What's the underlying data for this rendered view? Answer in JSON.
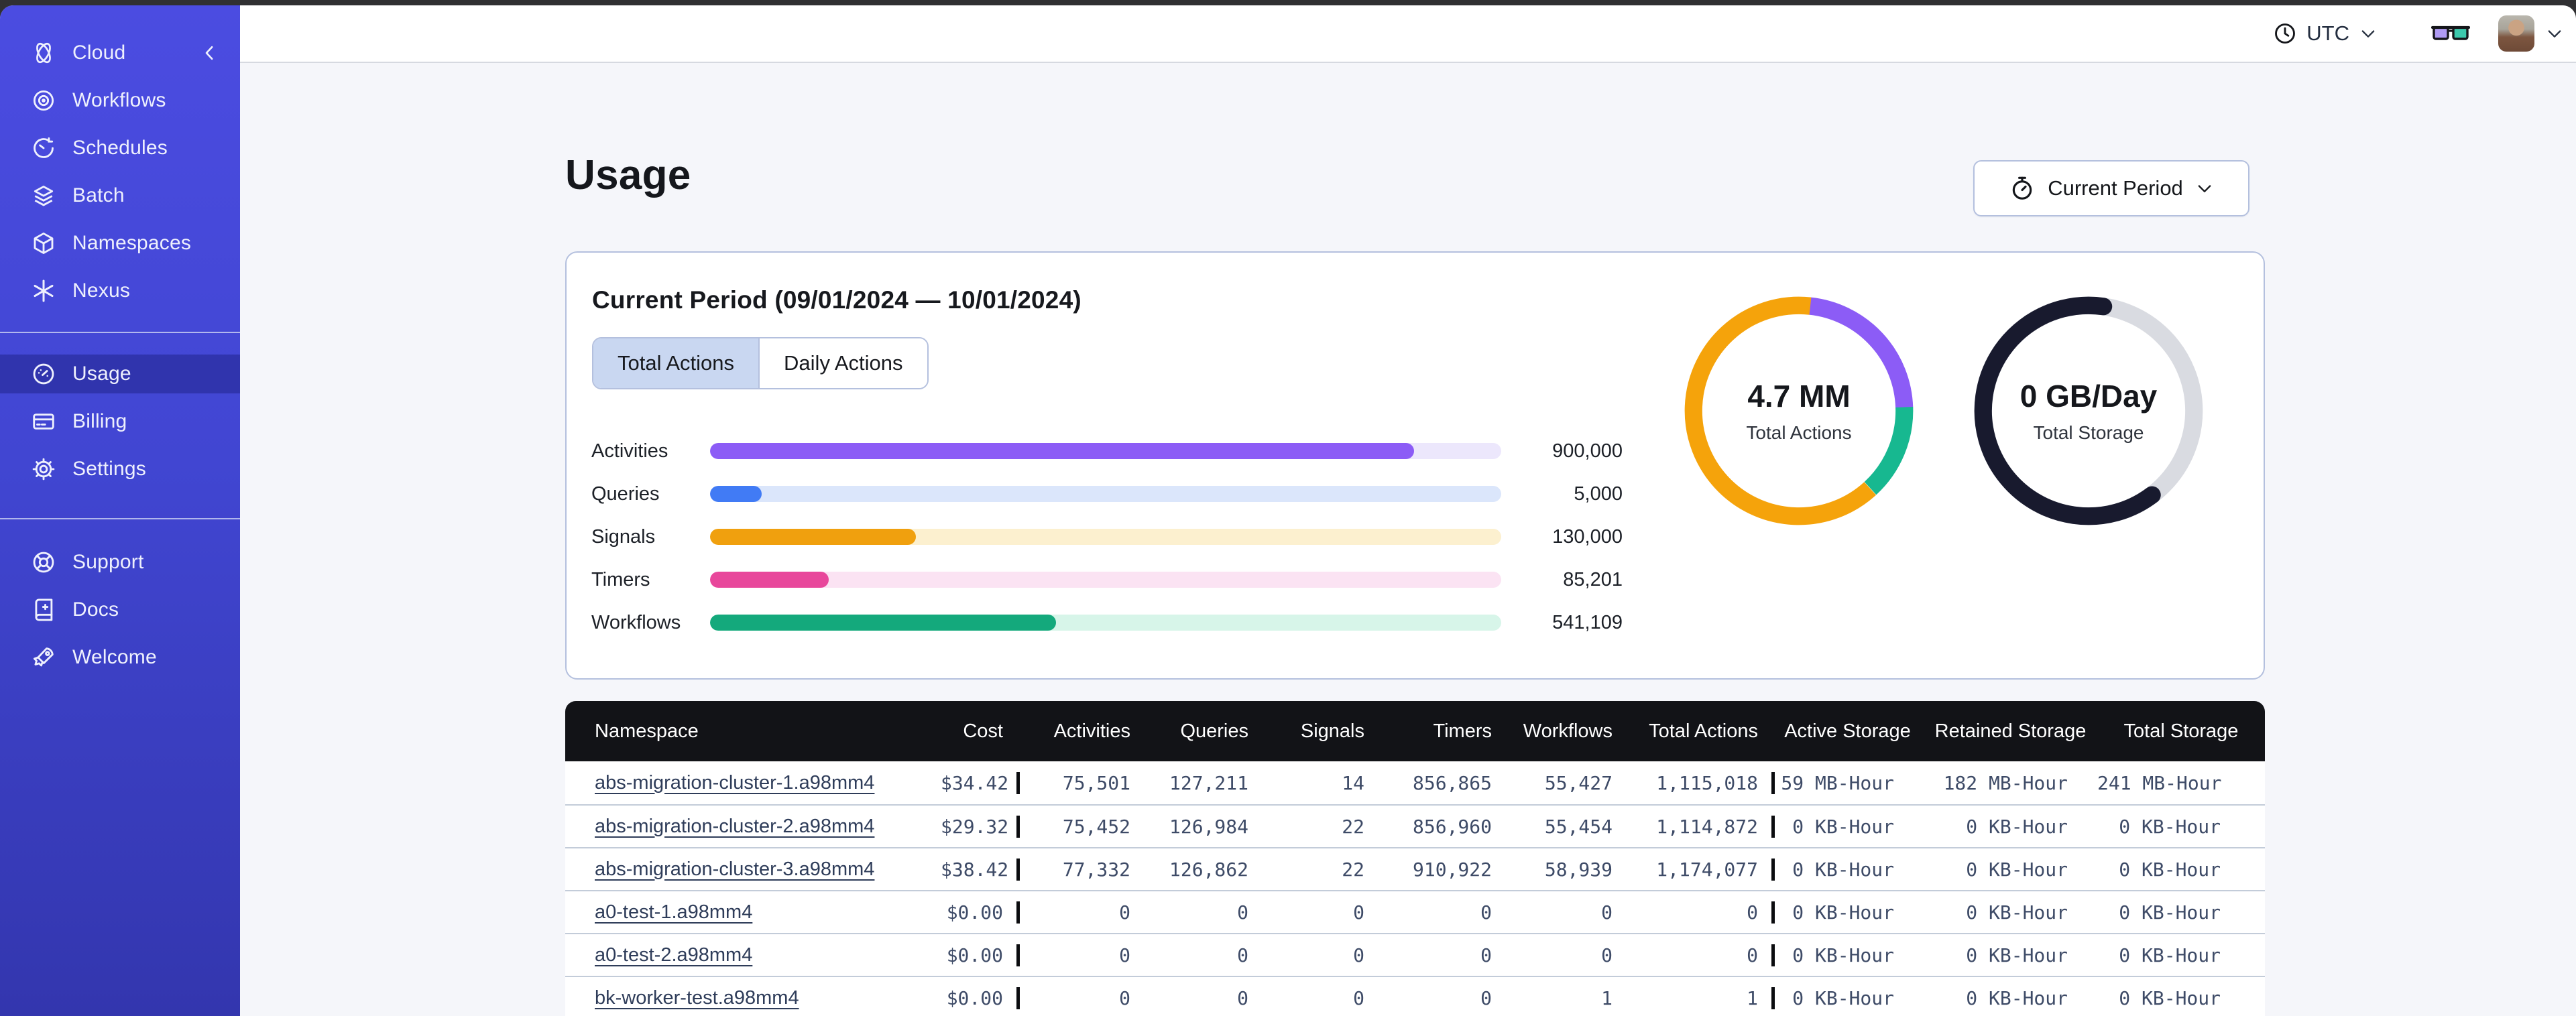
{
  "sidebar": {
    "brand": {
      "label": "Cloud"
    },
    "nav_top": [
      {
        "id": "workflows",
        "label": "Workflows"
      },
      {
        "id": "schedules",
        "label": "Schedules"
      },
      {
        "id": "batch",
        "label": "Batch"
      },
      {
        "id": "namespaces",
        "label": "Namespaces"
      },
      {
        "id": "nexus",
        "label": "Nexus"
      }
    ],
    "nav_account": [
      {
        "id": "usage",
        "label": "Usage",
        "active": true
      },
      {
        "id": "billing",
        "label": "Billing",
        "active": false
      },
      {
        "id": "settings",
        "label": "Settings",
        "active": false
      }
    ],
    "nav_help": [
      {
        "id": "support",
        "label": "Support"
      },
      {
        "id": "docs",
        "label": "Docs"
      },
      {
        "id": "welcome",
        "label": "Welcome"
      }
    ]
  },
  "topbar": {
    "timezone": "UTC"
  },
  "page": {
    "title": "Usage",
    "period_button": "Current Period"
  },
  "usage_card": {
    "title": "Current Period (09/01/2024 — 10/01/2024)",
    "tabs": [
      {
        "label": "Total Actions",
        "selected": true
      },
      {
        "label": "Daily Actions",
        "selected": false
      }
    ]
  },
  "chart_data": [
    {
      "type": "bar",
      "orientation": "horizontal",
      "bars": [
        {
          "label": "Activities",
          "value": 900000,
          "display_value": "900,000",
          "pct": 89,
          "color": "#8c5cf6",
          "track_color": "#ece7fc"
        },
        {
          "label": "Queries",
          "value": 5000,
          "display_value": "5,000",
          "pct": 6.5,
          "color": "#417bf5",
          "track_color": "#dbe6fb"
        },
        {
          "label": "Signals",
          "value": 130000,
          "display_value": "130,000",
          "pct": 26,
          "color": "#f0a00e",
          "track_color": "#fcf0cf"
        },
        {
          "label": "Timers",
          "value": 85201,
          "display_value": "85,201",
          "pct": 15,
          "color": "#e8479b",
          "track_color": "#fbe3f3"
        },
        {
          "label": "Workflows",
          "value": 541109,
          "display_value": "541,109",
          "pct": 43.7,
          "color": "#14a97c",
          "track_color": "#d7f5e9"
        }
      ]
    },
    {
      "type": "donut",
      "center_label": "4.7 MM",
      "center_sublabel": "Total Actions",
      "segments": [
        {
          "name": "activities",
          "color": "#8c5cf6",
          "pct": 22.8,
          "start_deg": 6
        },
        {
          "name": "workflows",
          "color": "#17b890",
          "pct": 13.7,
          "start_deg": 88
        },
        {
          "name": "other",
          "color": "#f5a30b",
          "pct": 63.5,
          "start_deg": 137.5
        }
      ],
      "rounded": false
    },
    {
      "type": "donut",
      "center_label": "0 GB/Day",
      "center_sublabel": "Total Storage",
      "track_color": "#d9dbe1",
      "segments": [
        {
          "name": "used",
          "color": "#181a2e",
          "pct": 62.5,
          "start_deg": 143
        }
      ],
      "rounded": true
    }
  ],
  "table": {
    "columns": [
      "Namespace",
      "Cost",
      "Activities",
      "Queries",
      "Signals",
      "Timers",
      "Workflows",
      "Total Actions",
      "Active Storage",
      "Retained Storage",
      "Total Storage"
    ],
    "rows": [
      {
        "cells": [
          "abs-migration-cluster-1.a98mm4",
          "$34.42",
          "75,501",
          "127,211",
          "14",
          "856,865",
          "55,427",
          "1,115,018",
          "59 MB-Hour",
          "182 MB-Hour",
          "241 MB-Hour"
        ]
      },
      {
        "cells": [
          "abs-migration-cluster-2.a98mm4",
          "$29.32",
          "75,452",
          "126,984",
          "22",
          "856,960",
          "55,454",
          "1,114,872",
          "0 KB-Hour",
          "0 KB-Hour",
          "0 KB-Hour"
        ]
      },
      {
        "cells": [
          "abs-migration-cluster-3.a98mm4",
          "$38.42",
          "77,332",
          "126,862",
          "22",
          "910,922",
          "58,939",
          "1,174,077",
          "0 KB-Hour",
          "0 KB-Hour",
          "0 KB-Hour"
        ]
      },
      {
        "cells": [
          "a0-test-1.a98mm4",
          "$0.00",
          "0",
          "0",
          "0",
          "0",
          "0",
          "0",
          "0 KB-Hour",
          "0 KB-Hour",
          "0 KB-Hour"
        ]
      },
      {
        "cells": [
          "a0-test-2.a98mm4",
          "$0.00",
          "0",
          "0",
          "0",
          "0",
          "0",
          "0",
          "0 KB-Hour",
          "0 KB-Hour",
          "0 KB-Hour"
        ]
      },
      {
        "cells": [
          "bk-worker-test.a98mm4",
          "$0.00",
          "0",
          "0",
          "0",
          "0",
          "1",
          "1",
          "0 KB-Hour",
          "0 KB-Hour",
          "0 KB-Hour"
        ]
      }
    ]
  }
}
